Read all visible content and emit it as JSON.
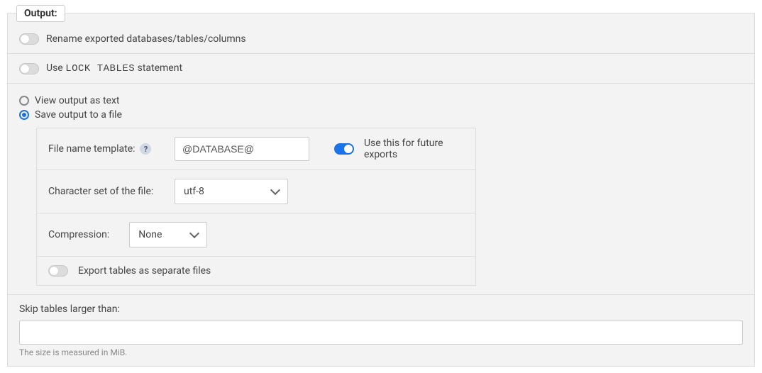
{
  "legend": "Output:",
  "rename": {
    "label": "Rename exported databases/tables/columns",
    "checked": false
  },
  "locktables": {
    "prefix": "Use ",
    "code": "LOCK TABLES",
    "suffix": " statement",
    "checked": false
  },
  "output_mode": {
    "view_text": "View output as text",
    "save_file": "Save output to a file",
    "selected": "save_file"
  },
  "file": {
    "template_label": "File name template:",
    "template_value": "@DATABASE@",
    "future_label": "Use this for future exports",
    "future_checked": true,
    "charset_label": "Character set of the file:",
    "charset_value": "utf-8",
    "compression_label": "Compression:",
    "compression_value": "None",
    "separate_label": "Export tables as separate files",
    "separate_checked": false
  },
  "skip": {
    "label": "Skip tables larger than:",
    "value": "",
    "hint": "The size is measured in MiB."
  }
}
